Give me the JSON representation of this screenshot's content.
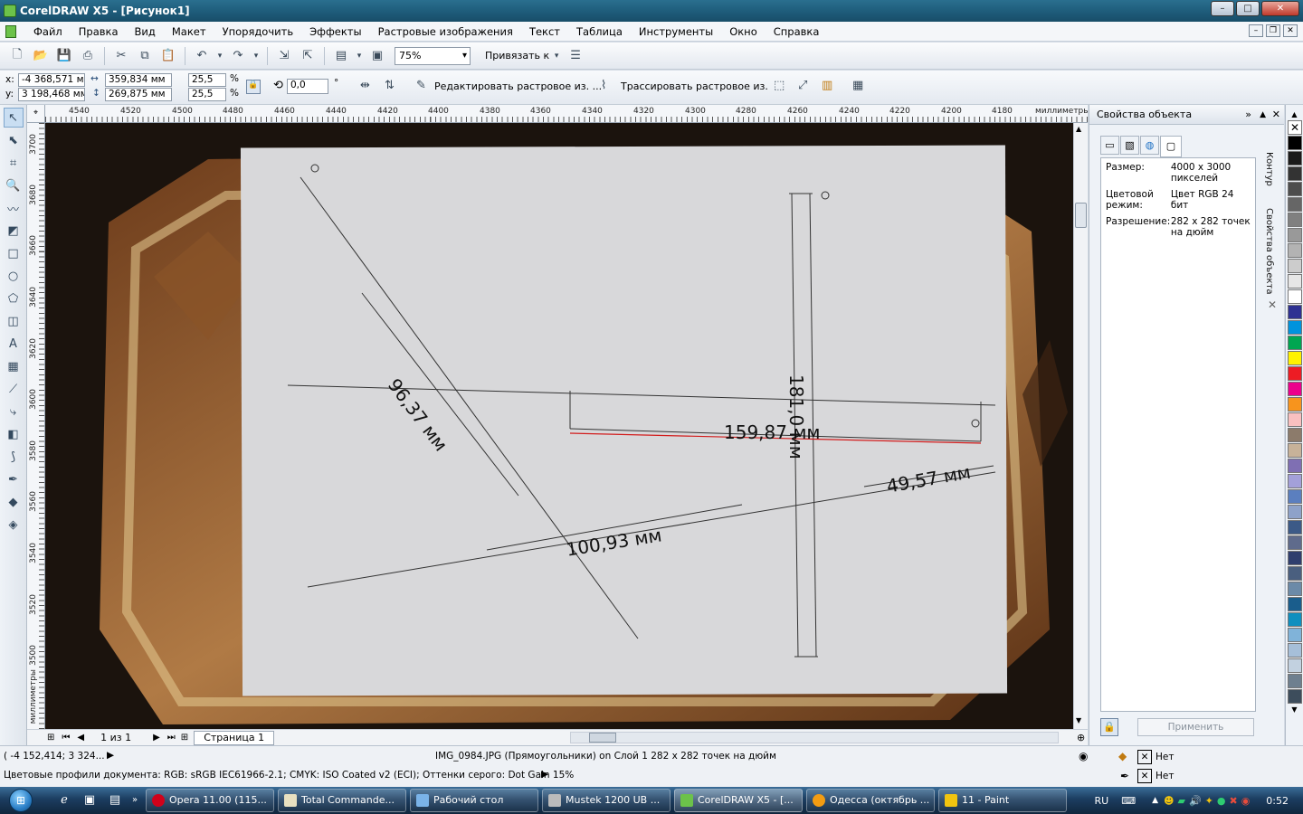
{
  "window": {
    "title": "CorelDRAW X5 - [Рисунок1]"
  },
  "menu": [
    "Файл",
    "Правка",
    "Вид",
    "Макет",
    "Упорядочить",
    "Эффекты",
    "Растровые изображения",
    "Текст",
    "Таблица",
    "Инструменты",
    "Окно",
    "Справка"
  ],
  "toolbar": {
    "zoom": "75%",
    "snap": "Привязать к"
  },
  "propbar": {
    "x_label": "x:",
    "x": "-4 368,571 мм",
    "y_label": "y:",
    "y": "3 198,468 мм",
    "w": "359,834 мм",
    "h": "269,875 мм",
    "sx": "25,5",
    "sy": "25,5",
    "pct": "%",
    "angle": "0,0",
    "deg": "°",
    "edit_bitmap": "Редактировать растровое из. ...",
    "trace_bitmap": "Трассировать растровое из."
  },
  "ruler_h": [
    "4540",
    "4520",
    "4500",
    "4480",
    "4460",
    "4440",
    "4420",
    "4400",
    "4380",
    "4360",
    "4340",
    "4320",
    "4300",
    "4280",
    "4260",
    "4240",
    "4220",
    "4200",
    "4180"
  ],
  "ruler_h_unit": "миллиметры",
  "ruler_v": [
    "3700",
    "3680",
    "3660",
    "3640",
    "3620",
    "3600",
    "3580",
    "3560",
    "3540",
    "3520",
    "3500"
  ],
  "ruler_v_unit": "миллиметры",
  "canvas_labels": {
    "d1": "96,37 мм",
    "d2": "159,87 мм",
    "d3": "181,0 мм",
    "d4": "49,57 мм",
    "d5": "100,93 мм"
  },
  "docker": {
    "title": "Свойства объекта",
    "size_label": "Размер:",
    "size_value": "4000 x 3000 пикселей",
    "color_label": "Цветовой режим:",
    "color_value": "Цвет RGB 24 бит",
    "res_label": "Разрешение:",
    "res_value": "282 x 282 точек на дюйм",
    "apply": "Применить",
    "tab_contour": "Контур",
    "tab_props": "Свойства объекта"
  },
  "page_nav": {
    "count": "1 из 1",
    "page_tab": "Страница 1"
  },
  "status": {
    "coords": "( -4 152,414; 3 324...",
    "object": "IMG_0984.JPG (Прямоугольники) on Слой 1 282 x 282 точек на дюйм",
    "profiles": "Цветовые профили документа: RGB: sRGB IEC61966-2.1; CMYK: ISO Coated v2 (ECI); Оттенки серого: Dot Gain 15%",
    "fill": "Нет",
    "outline": "Нет"
  },
  "taskbar": {
    "tasks": [
      "Opera 11.00 (115...",
      "Total Commande...",
      "Рабочий стол",
      "Mustek 1200 UB ...",
      "CorelDRAW X5 - [...",
      "Одесса (октябрь ...",
      "11 - Paint"
    ],
    "lang": "RU",
    "time": "0:52"
  },
  "palette_colors": [
    "#ffffff",
    "#000000",
    "#1a1a1a",
    "#333333",
    "#4d4d4d",
    "#666666",
    "#808080",
    "#999999",
    "#b3b3b3",
    "#cccccc",
    "#e6e6e6",
    "#ffffff",
    "#2e3192",
    "#0093dd",
    "#00a651",
    "#fff200",
    "#ed1c24",
    "#ec008c",
    "#f7941d",
    "#f9c0c0",
    "#8c7b6b",
    "#c7b299",
    "#7f6fb3",
    "#a3a0d9",
    "#5b7fbf",
    "#8ea2c9",
    "#3c5a87",
    "#5f6b8c",
    "#2f3e6e",
    "#4a5f7f",
    "#6b8aa8",
    "#1a5d8c",
    "#0f8fbf",
    "#80b3d9",
    "#a6bfd9",
    "#c2d1e0",
    "#6e7f8f",
    "#3d4d5c"
  ]
}
